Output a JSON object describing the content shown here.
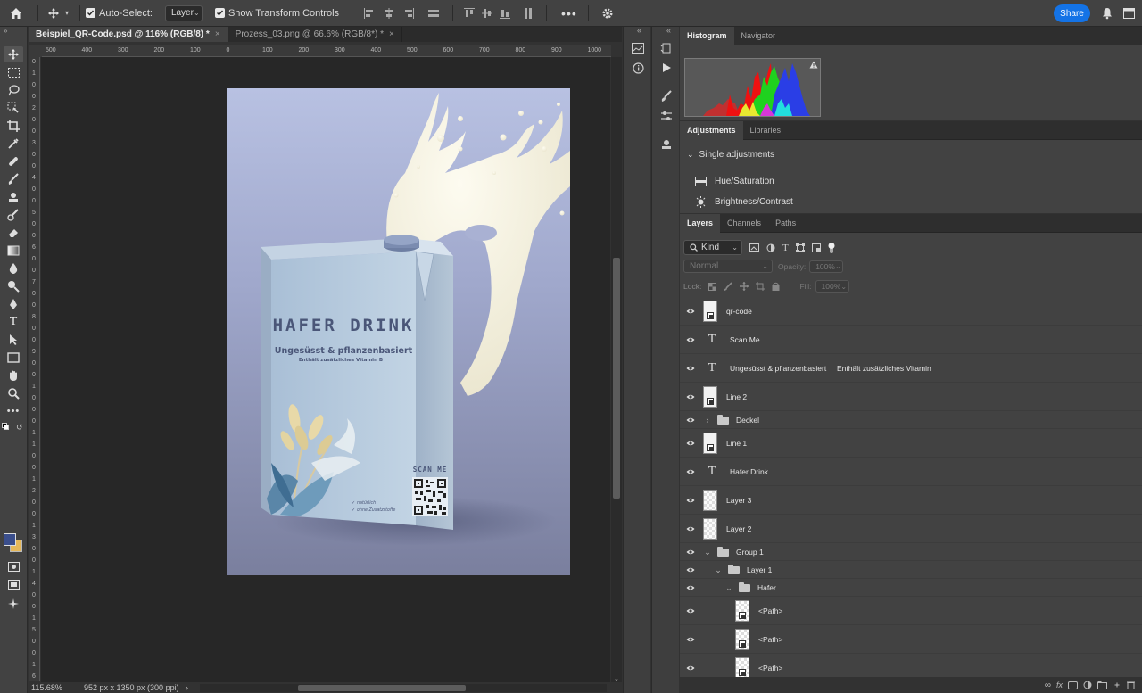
{
  "option_bar": {
    "auto_select_label": "Auto-Select:",
    "auto_select_target": "Layer",
    "transform_controls_label": "Show Transform Controls",
    "share_label": "Share"
  },
  "document_tabs": [
    {
      "label": "Beispiel_QR-Code.psd @ 116% (RGB/8) *",
      "close": "×"
    },
    {
      "label": "Prozess_03.png @ 66.6% (RGB/8*) *",
      "close": "×"
    }
  ],
  "ruler": {
    "horizontal": [
      "500",
      "400",
      "300",
      "200",
      "100",
      "0",
      "100",
      "200",
      "300",
      "400",
      "500",
      "600",
      "700",
      "800",
      "900",
      "1000"
    ],
    "vertical": [
      "0",
      "1",
      "0",
      "0",
      "2",
      "0",
      "0",
      "3",
      "0",
      "0",
      "4",
      "0",
      "0",
      "5",
      "0",
      "0",
      "6",
      "0",
      "0",
      "7",
      "0",
      "0",
      "8",
      "0",
      "0",
      "9",
      "0",
      "0",
      "1",
      "0",
      "0",
      "0",
      "1",
      "1",
      "0",
      "0",
      "1",
      "2",
      "0",
      "0",
      "1",
      "3",
      "0",
      "0",
      "1",
      "4",
      "0",
      "0",
      "1",
      "5",
      "0",
      "0",
      "1",
      "6"
    ]
  },
  "status": {
    "zoom": "115.68%",
    "doc_info": "952 px x 1350 px (300 ppi)",
    "arrow": "›"
  },
  "artwork": {
    "title": "HAFER DRINK",
    "subtitle": "Ungesüsst & pflanzenbasiert",
    "subline": "Enthält zusätzliches Vitamin B",
    "scan": "SCAN ME",
    "check1": "natürlich",
    "check2": "ohne Zusatzstoffe",
    "colors": {
      "bg_top": "#b6bfe0",
      "bg_bottom": "#777d9c",
      "carton": "#b3c8dc",
      "ink": "#4a5678"
    }
  },
  "panels": {
    "histogram_tabs": [
      "Histogram",
      "Navigator"
    ],
    "adjustments_tabs": [
      "Adjustments",
      "Libraries"
    ],
    "single_adjustments": "Single adjustments",
    "adjustments": [
      "Hue/Saturation",
      "Brightness/Contrast"
    ],
    "layers_tabs": [
      "Layers",
      "Channels",
      "Paths"
    ],
    "kind_filter": "Kind",
    "blend_mode": "Normal",
    "opacity_label": "Opacity:",
    "opacity_value": "100%",
    "lock_label": "Lock:",
    "fill_label": "Fill:",
    "fill_value": "100%"
  },
  "layers": [
    {
      "name": "qr-code",
      "type": "smart"
    },
    {
      "name": "Scan Me",
      "type": "text"
    },
    {
      "name": "Ungesüsst & pflanzenbasiert     Enthält zusätzliches Vitamin",
      "type": "text"
    },
    {
      "name": "Line 2",
      "type": "smart"
    },
    {
      "name": "Deckel",
      "type": "group"
    },
    {
      "name": "Line 1",
      "type": "smart"
    },
    {
      "name": "Hafer Drink",
      "type": "text"
    },
    {
      "name": "Layer 3",
      "type": "pixel"
    },
    {
      "name": "Layer 2",
      "type": "pixel"
    },
    {
      "name": "Group 1",
      "type": "group"
    },
    {
      "name": "Layer 1",
      "type": "group"
    },
    {
      "name": "Hafer",
      "type": "group"
    },
    {
      "name": "<Path>",
      "type": "smart"
    },
    {
      "name": "<Path>",
      "type": "smart"
    },
    {
      "name": "<Path>",
      "type": "smart"
    }
  ]
}
